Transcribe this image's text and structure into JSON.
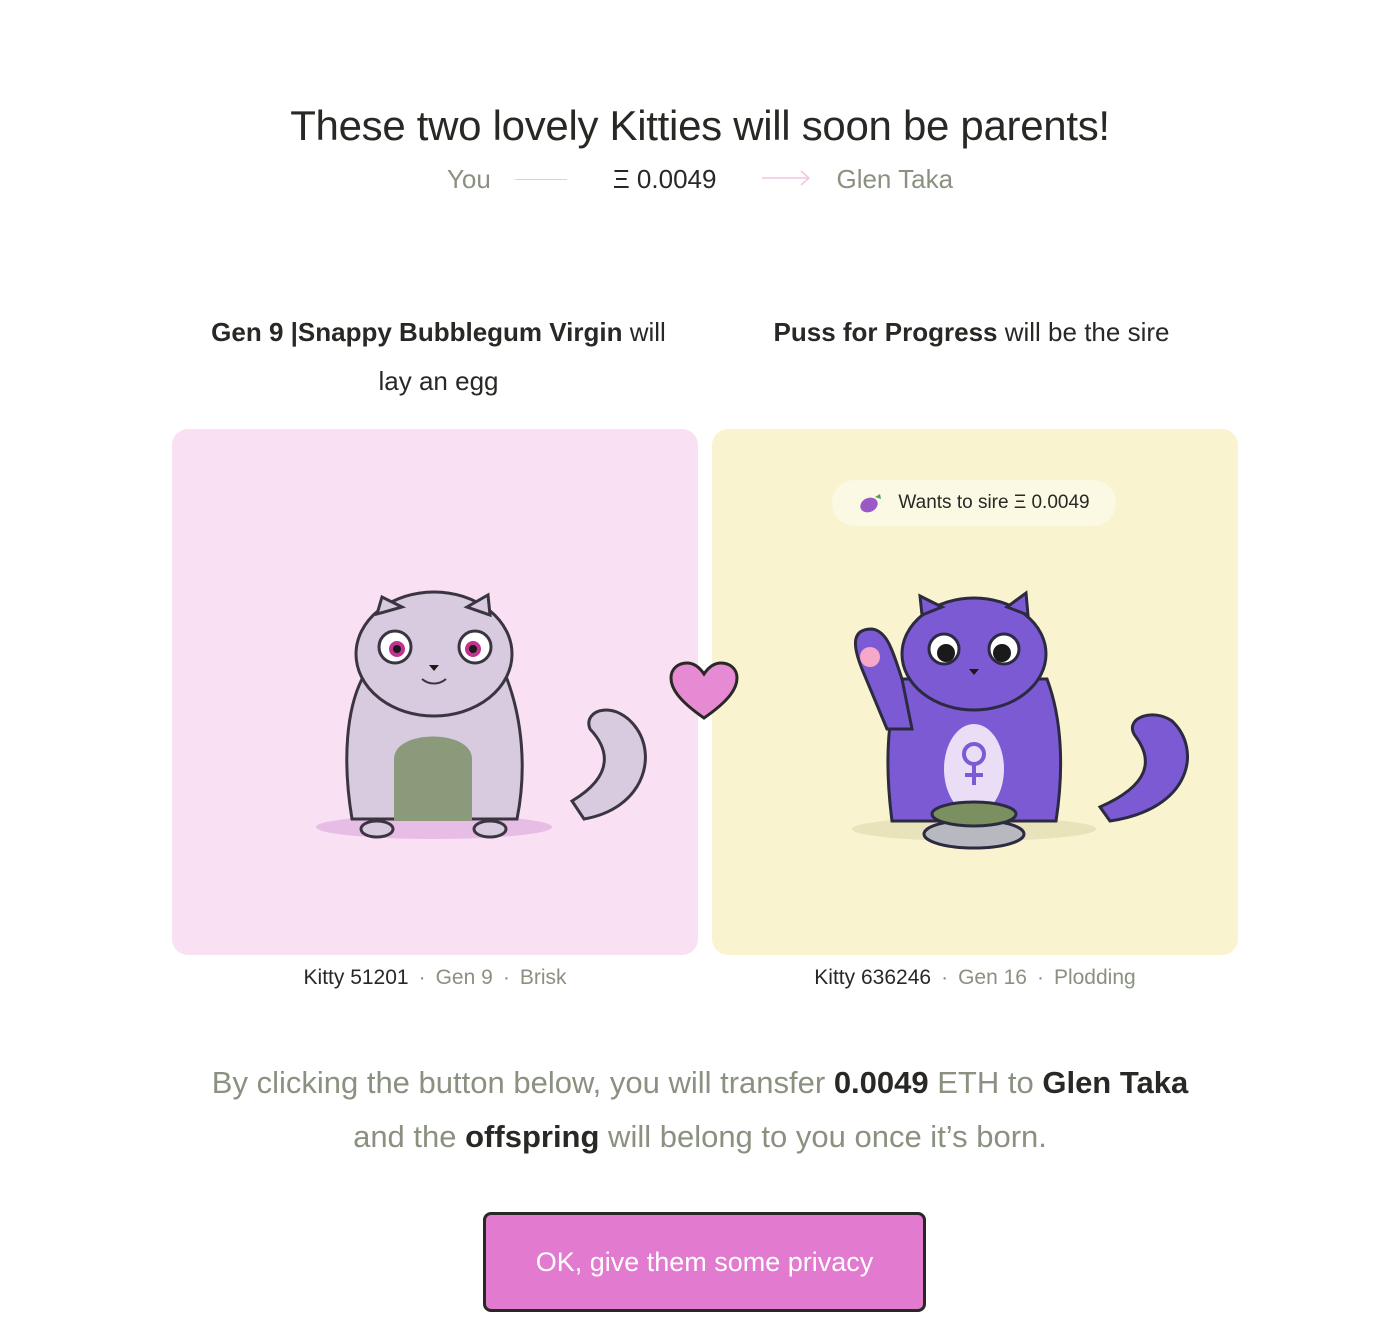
{
  "page": {
    "title": "These two lovely Kitties will soon be parents!"
  },
  "transfer": {
    "from": "You",
    "amount": "Ξ 0.0049",
    "to": "Glen Taka"
  },
  "captions": {
    "dam_name": "Gen 9 |Snappy Bubblegum Virgin",
    "dam_text": " will lay an egg",
    "sire_name": "Puss for Progress",
    "sire_text": " will be the sire"
  },
  "dam": {
    "kitty": "Kitty 51201",
    "gen": "Gen 9",
    "speed": "Brisk",
    "card_color": "#fae0f3"
  },
  "sire": {
    "badge": "Wants to sire  Ξ 0.0049",
    "kitty": "Kitty 636246",
    "gen": "Gen 16",
    "speed": "Plodding",
    "card_color": "#f9f4cf"
  },
  "explanation": {
    "p1": "By clicking the button below, you will transfer ",
    "amount": "0.0049",
    "p2": " ETH to ",
    "recipient": "Glen Taka",
    "p3": " and the ",
    "offspring": "offspring",
    "p4": " will belong to you once it’s born."
  },
  "button": {
    "label": "OK, give them some privacy",
    "color": "#e27ad0"
  },
  "icons": [
    "arrow-right-icon",
    "eggplant-icon",
    "heart-icon"
  ]
}
